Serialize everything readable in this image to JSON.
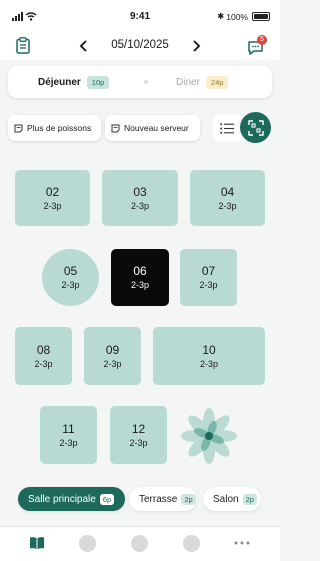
{
  "status": {
    "time": "9:41",
    "battery": "100%"
  },
  "header": {
    "date": "05/10/2025",
    "notification_count": "5"
  },
  "services": [
    {
      "label": "Déjeuner",
      "count": "10p",
      "active": true
    },
    {
      "label": "Diner",
      "count": "24p",
      "active": false
    }
  ],
  "filters": [
    {
      "label": "Plus de poissons"
    },
    {
      "label": "Nouveau serveur"
    }
  ],
  "tables": [
    {
      "number": "02",
      "capacity": "2-3p"
    },
    {
      "number": "03",
      "capacity": "2-3p"
    },
    {
      "number": "04",
      "capacity": "2-3p"
    },
    {
      "number": "05",
      "capacity": "2-3p"
    },
    {
      "number": "06",
      "capacity": "2-3p",
      "selected": true
    },
    {
      "number": "07",
      "capacity": "2-3p"
    },
    {
      "number": "08",
      "capacity": "2-3p"
    },
    {
      "number": "09",
      "capacity": "2-3p"
    },
    {
      "number": "10",
      "capacity": "2-3p"
    },
    {
      "number": "11",
      "capacity": "2-3p"
    },
    {
      "number": "12",
      "capacity": "2-3p"
    }
  ],
  "rooms": [
    {
      "label": "Salle principale",
      "count": "6p",
      "active": true
    },
    {
      "label": "Terrasse",
      "count": "2p"
    },
    {
      "label": "Salon",
      "count": "2p"
    }
  ],
  "colors": {
    "accent": "#1d6a5d",
    "table": "#b9d9d3",
    "selected_table": "#0a0a0a",
    "notification": "#e0463c"
  },
  "icons": {
    "header_left": "clipboard-icon",
    "header_right": "chat-icon",
    "filter": "note-icon",
    "list": "list-icon",
    "scan": "qr-scan-icon",
    "decoration": "lotus-icon",
    "tab_book": "book-icon",
    "tab_more": "more-icon"
  }
}
